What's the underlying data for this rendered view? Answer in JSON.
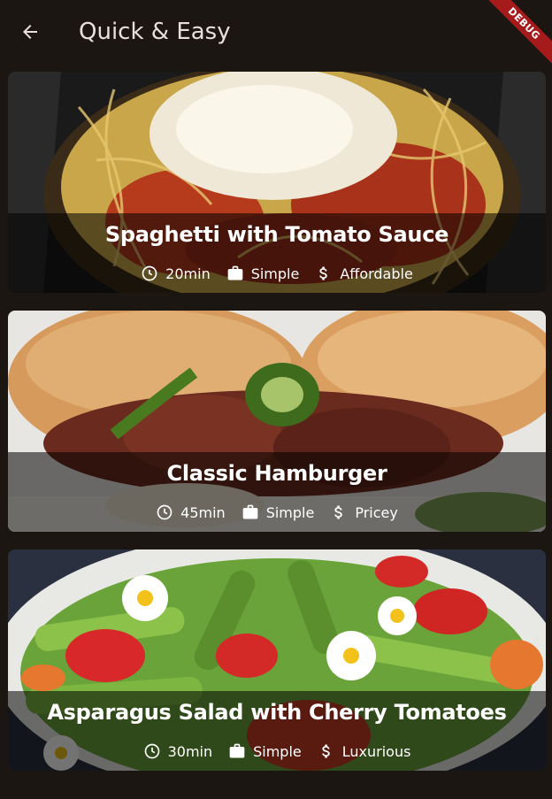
{
  "app_bar": {
    "title": "Quick & Easy",
    "back_icon": "arrow-back-icon",
    "debug_label": "DEBUG"
  },
  "meals": [
    {
      "title": "Spaghetti with Tomato Sauce",
      "duration": "20min",
      "complexity": "Simple",
      "affordability": "Affordable",
      "image_subject": "spaghetti"
    },
    {
      "title": "Classic Hamburger",
      "duration": "45min",
      "complexity": "Simple",
      "affordability": "Pricey",
      "image_subject": "hamburger"
    },
    {
      "title": "Asparagus Salad with Cherry Tomatoes",
      "duration": "30min",
      "complexity": "Simple",
      "affordability": "Luxurious",
      "image_subject": "salad"
    }
  ],
  "icons": {
    "duration": "clock-icon",
    "complexity": "work-icon",
    "affordability": "dollar-icon"
  },
  "colors": {
    "background": "#1c1613",
    "title_text": "#e9e0dd",
    "debug_banner": "#a51a1a"
  }
}
